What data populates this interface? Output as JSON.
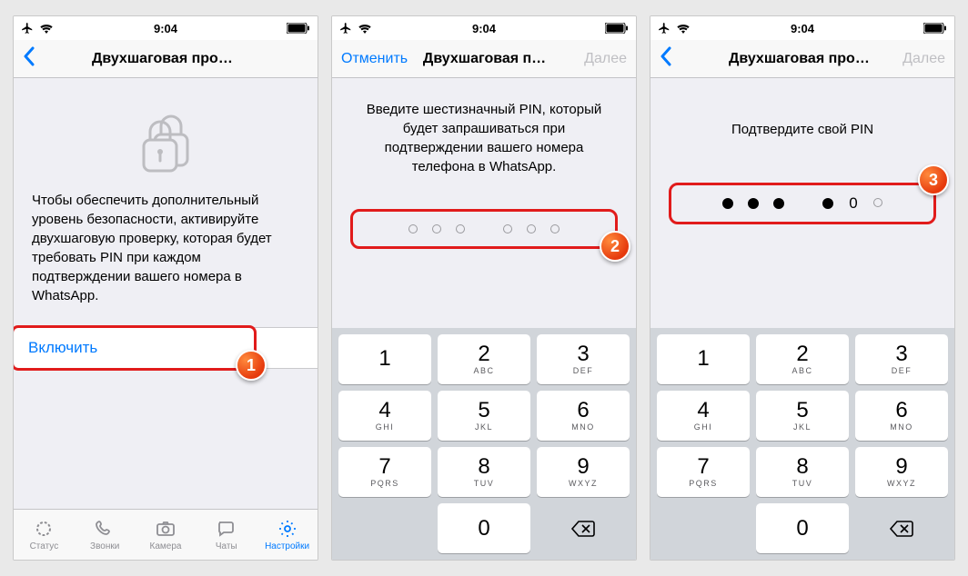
{
  "statusbar": {
    "time": "9:04"
  },
  "screens": [
    {
      "nav": {
        "left": "",
        "title": "Двухшаговая проверка",
        "right": ""
      },
      "desc": "Чтобы обеспечить дополнительный уровень безопасности, активируйте двухшаговую проверку, которая будет требовать PIN при каждом подтверждении вашего номера в WhatsApp.",
      "enable_label": "Включить",
      "tabs": {
        "status": "Статус",
        "calls": "Звонки",
        "camera": "Камера",
        "chats": "Чаты",
        "settings": "Настройки"
      },
      "badge": "1"
    },
    {
      "nav": {
        "left": "Отменить",
        "title": "Двухшаговая п…",
        "right": "Далее"
      },
      "desc": "Введите шестизначный PIN, который будет запрашиваться при подтверждении вашего номера телефона в WhatsApp.",
      "badge": "2",
      "keypad": {
        "1": "",
        "2": "ABC",
        "3": "DEF",
        "4": "GHI",
        "5": "JKL",
        "6": "MNO",
        "7": "PQRS",
        "8": "TUV",
        "9": "WXYZ",
        "0": ""
      }
    },
    {
      "nav": {
        "left": "",
        "title": "Двухшаговая проверка",
        "right": "Далее"
      },
      "desc": "Подтвердите свой PIN",
      "pin_digit": "0",
      "badge": "3",
      "keypad": {
        "1": "",
        "2": "ABC",
        "3": "DEF",
        "4": "GHI",
        "5": "JKL",
        "6": "MNO",
        "7": "PQRS",
        "8": "TUV",
        "9": "WXYZ",
        "0": ""
      }
    }
  ]
}
